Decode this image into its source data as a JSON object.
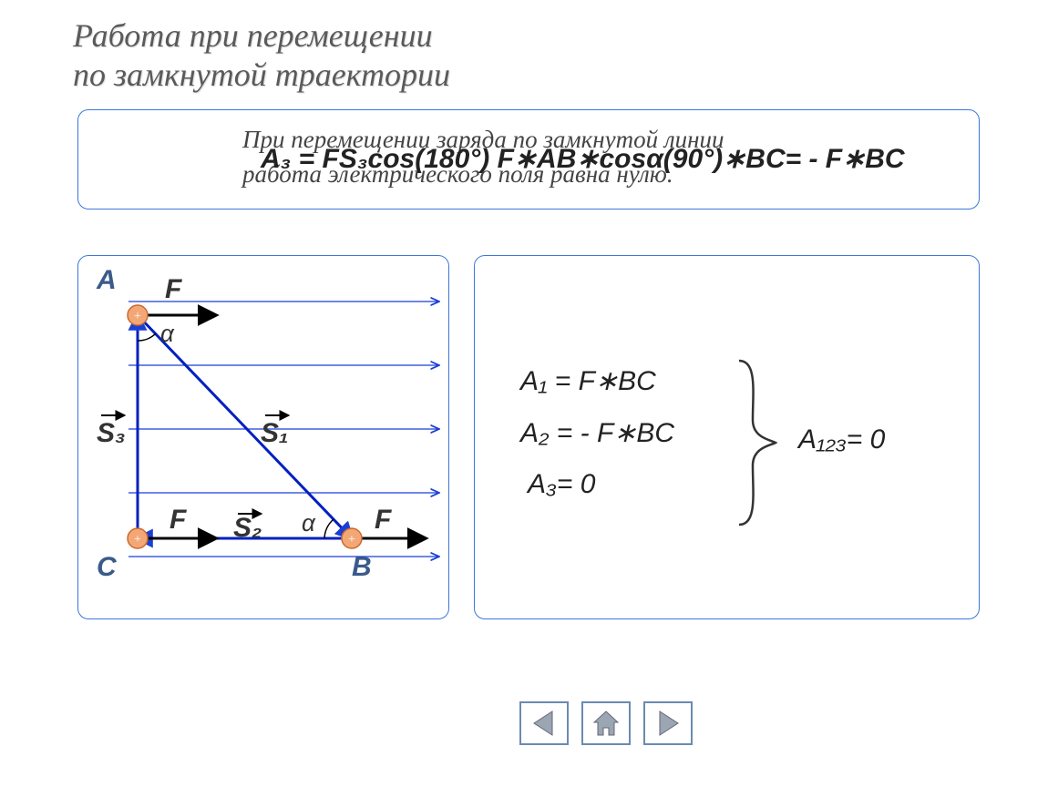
{
  "title_line1": "Работа при перемещении",
  "title_line2": "по замкнутой траектории",
  "top_text_line1": "При перемещении заряда по замкнутой линии",
  "top_text_line2": "работа электрического поля равна нулю.",
  "top_formula_overlay": "A₃ = FS₃cos(180°) F∗AB∗cosα(90°)∗BC= - F∗BC",
  "equations": {
    "a1": "A₁ = F∗BC",
    "a2": "A₂ = - F∗BC",
    "a3": "A₃= 0",
    "sum": "A₁₂₃= 0"
  },
  "diagram_labels": {
    "A": "A",
    "B": "B",
    "C": "C",
    "F1": "F",
    "F2": "F",
    "F3": "F",
    "S1": "S₁",
    "S2": "S₂",
    "S3": "S₃",
    "alpha1": "α",
    "alpha2": "α"
  },
  "nav": {
    "prev": "previous",
    "home": "home",
    "next": "next"
  }
}
